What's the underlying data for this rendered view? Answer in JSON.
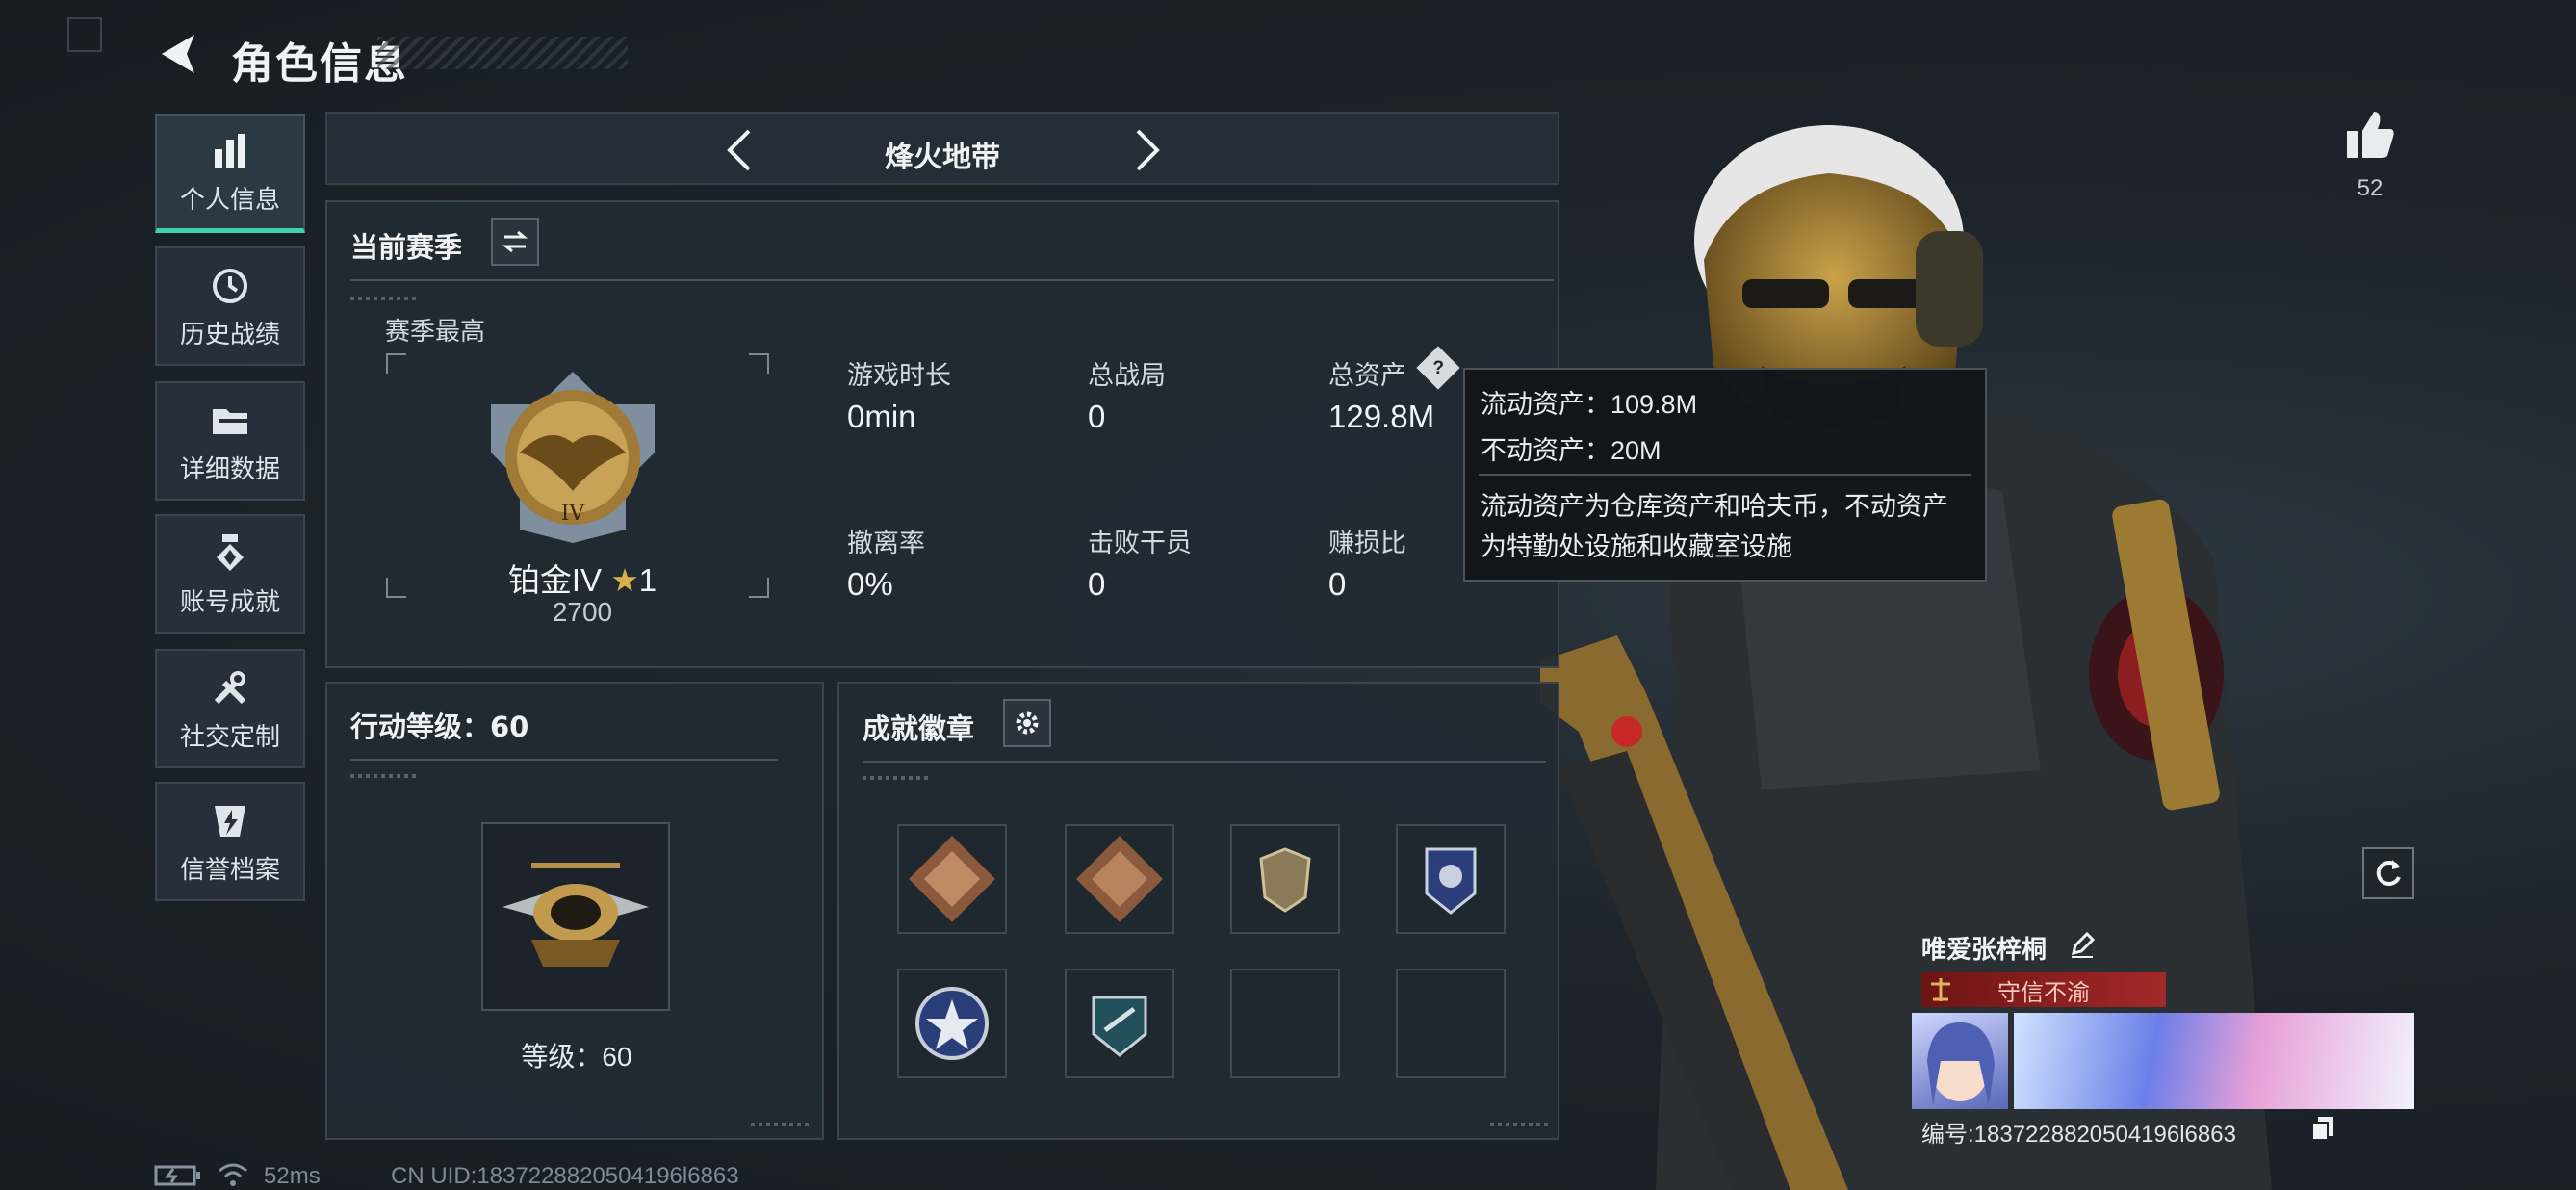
{
  "header": {
    "title": "角色信息"
  },
  "sidebar": {
    "items": [
      {
        "label": "个人信息",
        "icon": "bar-chart-icon",
        "active": true
      },
      {
        "label": "历史战绩",
        "icon": "history-icon"
      },
      {
        "label": "详细数据",
        "icon": "folder-icon"
      },
      {
        "label": "账号成就",
        "icon": "medal-icon"
      },
      {
        "label": "社交定制",
        "icon": "tools-icon"
      },
      {
        "label": "信誉档案",
        "icon": "shield-lightning-icon"
      }
    ]
  },
  "mode_tab": {
    "title": "烽火地带"
  },
  "season": {
    "title": "当前赛季",
    "best_label": "赛季最高",
    "rank_name": "铂金IV",
    "rank_stars": "1",
    "rank_score": "2700",
    "stats": [
      {
        "label": "游戏时长",
        "value": "0min"
      },
      {
        "label": "总战局",
        "value": "0"
      },
      {
        "label": "总资产",
        "value": "129.8M"
      },
      {
        "label": "撤离率",
        "value": "0%"
      },
      {
        "label": "击败干员",
        "value": "0"
      },
      {
        "label": "赚损比",
        "value": "0"
      }
    ]
  },
  "tooltip": {
    "liquid": "流动资产：109.8M",
    "fixed": "不动资产：20M",
    "desc_line1": "流动资产为仓库资产和哈夫币，不动资产",
    "desc_line2": "为特勤处设施和收藏室设施"
  },
  "action_level": {
    "title": "行动等级：60",
    "level_text": "等级：60"
  },
  "badges": {
    "title": "成就徽章",
    "items": [
      "dragon-diamond-badge",
      "dragon-diamond-badge-2",
      "shield-badge",
      "blue-shield-badge",
      "star-badge",
      "arrow-shield-badge",
      "",
      ""
    ]
  },
  "profile": {
    "likes": "52",
    "player_name": "唯爱张梓桐",
    "title_tag": "守信不渝",
    "id_text": "编号:1837228820504196l6863"
  },
  "status": {
    "ping": "52ms",
    "uid": "CN UID:1837228820504196l6863"
  },
  "colors": {
    "accent": "#3fd1b0",
    "tag_red": "#8a1e1e",
    "panel": "#222a32"
  }
}
